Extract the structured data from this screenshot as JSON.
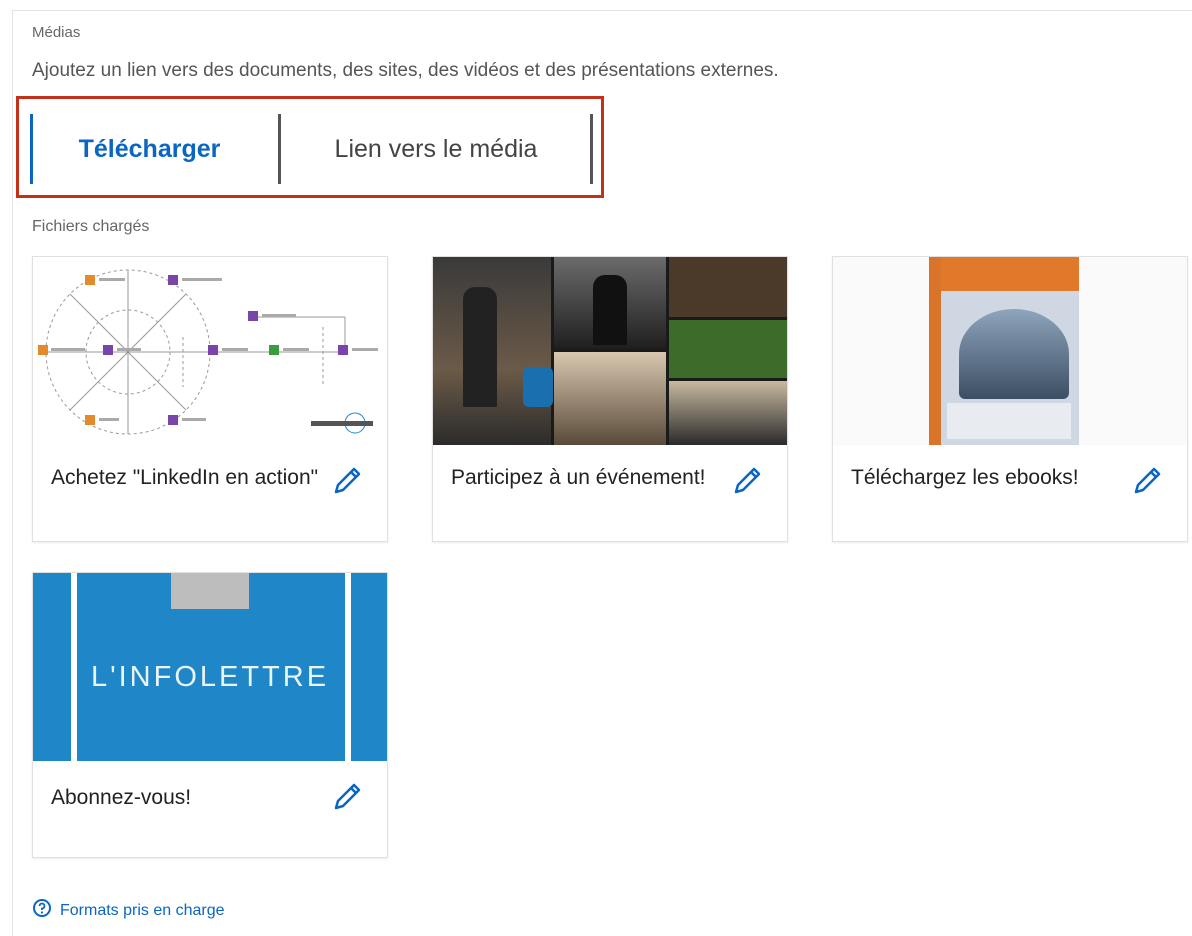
{
  "section": {
    "label": "Médias",
    "description": "Ajoutez un lien vers des documents, des sites, des vidéos et des présentations externes."
  },
  "tabs": [
    {
      "label": "Télécharger",
      "active": true
    },
    {
      "label": "Lien vers le média",
      "active": false
    }
  ],
  "files_label": "Fichiers chargés",
  "cards": [
    {
      "title": "Achetez \"LinkedIn en action\"",
      "thumb_icon": "diagram-thumbnail"
    },
    {
      "title": "Participez à un événement!",
      "thumb_icon": "event-photo-collage"
    },
    {
      "title": "Téléchargez les ebooks!",
      "thumb_icon": "ebook-cover"
    },
    {
      "title": "Abonnez-vous!",
      "thumb_icon": "newsletter-banner",
      "thumb_text": "L'INFOLETTRE"
    }
  ],
  "footer": {
    "help_label": "Formats pris en charge",
    "icon": "help-icon"
  },
  "colors": {
    "accent": "#0a66c2",
    "highlight": "#c4311b",
    "newsletter": "#1f86c8"
  }
}
